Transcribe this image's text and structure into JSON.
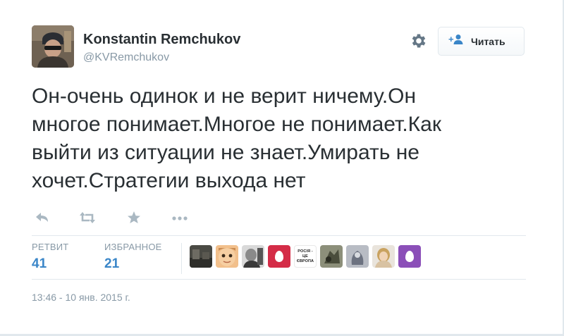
{
  "user": {
    "name": "Konstantin Remchukov",
    "handle": "@KVRemchukov"
  },
  "follow_button": {
    "label": "Читать"
  },
  "tweet": {
    "lines": [
      "Он-очень одинок и не верит ничему.Он",
      "многое понимает.Многое не понимает.Как",
      "выйти из ситуации не знает.Умирать не",
      "хочет.Стратегии выхода нет"
    ]
  },
  "actions": [
    "reply-icon",
    "retweet-icon",
    "favorite-icon",
    "more-icon"
  ],
  "stats": {
    "retweets": {
      "label": "РЕТВИТ",
      "value": "41"
    },
    "favorites": {
      "label": "ИЗБРАННОЕ",
      "value": "21"
    }
  },
  "favoriters": [
    {
      "type": "photo",
      "icon": "user-photo"
    },
    {
      "type": "photo",
      "icon": "user-photo"
    },
    {
      "type": "photo",
      "icon": "user-photo"
    },
    {
      "type": "egg",
      "icon": "default-egg-avatar"
    },
    {
      "type": "text",
      "lines": [
        "РОСІЯ -",
        "ЦЕ",
        "ЄВРОПА"
      ]
    },
    {
      "type": "photo",
      "icon": "user-photo"
    },
    {
      "type": "photo",
      "icon": "user-photo"
    },
    {
      "type": "photo",
      "icon": "user-photo"
    },
    {
      "type": "egg",
      "icon": "default-egg-avatar"
    }
  ],
  "colors": {
    "link": "#3a86c8",
    "muted": "#8899a6",
    "egg_red": "#d42c47",
    "egg_purple": "#8b4fb8"
  },
  "timestamp": "13:46 - 10 янв. 2015 г."
}
